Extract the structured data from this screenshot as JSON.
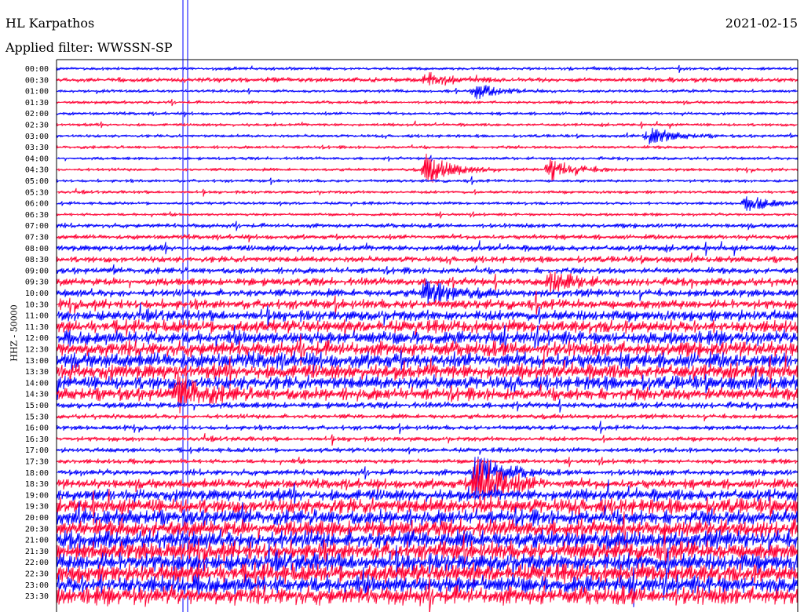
{
  "chart_data": {
    "type": "line",
    "station": "HL Karpathos",
    "date": "2021-02-15",
    "filter_label": "Applied filter: WWSSN-SP",
    "ylabel": "HHZ - 50000",
    "time_labels": [
      "00:00",
      "00:30",
      "01:00",
      "01:30",
      "02:00",
      "02:30",
      "03:00",
      "03:30",
      "04:00",
      "04:30",
      "05:00",
      "05:30",
      "06:00",
      "06:30",
      "07:00",
      "07:30",
      "08:00",
      "08:30",
      "09:00",
      "09:30",
      "10:00",
      "10:30",
      "11:00",
      "11:30",
      "12:00",
      "12:30",
      "13:00",
      "13:30",
      "14:00",
      "14:30",
      "15:00",
      "15:30",
      "16:00",
      "16:30",
      "17:00",
      "17:30",
      "18:00",
      "18:30",
      "19:00",
      "19:30",
      "20:00",
      "20:30",
      "21:00",
      "21:30",
      "22:00",
      "22:30",
      "23:00",
      "23:30"
    ],
    "series_colors": [
      "#0000ff",
      "#ff0033"
    ],
    "noise_levels": [
      2,
      3,
      2,
      2,
      2,
      2,
      2,
      2,
      2,
      2,
      2,
      2,
      2,
      2,
      3,
      3,
      4,
      4,
      4,
      5,
      5,
      6,
      7,
      8,
      9,
      10,
      10,
      10,
      9,
      8,
      4,
      3,
      3,
      3,
      3,
      3,
      4,
      6,
      8,
      10,
      10,
      11,
      12,
      12,
      12,
      12,
      12,
      12
    ],
    "events": [
      {
        "row": 1,
        "minute": 15,
        "amp": 8
      },
      {
        "row": 2,
        "minute": 17,
        "amp": 9
      },
      {
        "row": 6,
        "minute": 24,
        "amp": 11
      },
      {
        "row": 9,
        "minute": 15,
        "amp": 20
      },
      {
        "row": 9,
        "minute": 20,
        "amp": 15
      },
      {
        "row": 12,
        "minute": 28,
        "amp": 9
      },
      {
        "row": 19,
        "minute": 20,
        "amp": 14
      },
      {
        "row": 20,
        "minute": 15,
        "amp": 18
      },
      {
        "row": 29,
        "minute": 5,
        "amp": 22
      },
      {
        "row": 36,
        "minute": 17,
        "amp": 30
      },
      {
        "row": 37,
        "minute": 17,
        "amp": 45
      }
    ]
  }
}
